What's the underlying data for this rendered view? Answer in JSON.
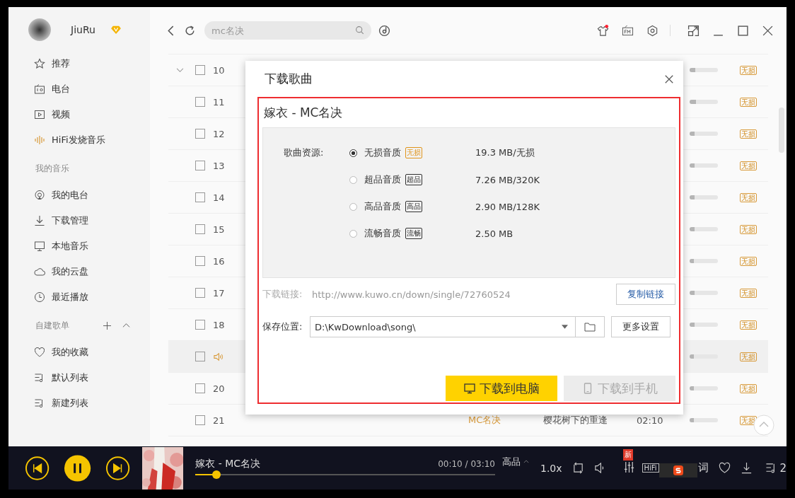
{
  "user": {
    "name": "JiuRu"
  },
  "search": {
    "placeholder": "mc名决"
  },
  "sidebar": {
    "items": [
      {
        "label": "推荐"
      },
      {
        "label": "电台"
      },
      {
        "label": "视频"
      },
      {
        "label": "HiFi发烧音乐"
      }
    ],
    "sections": [
      {
        "title": "我的音乐",
        "items": [
          {
            "label": "我的电台"
          },
          {
            "label": "下载管理"
          },
          {
            "label": "本地音乐"
          },
          {
            "label": "我的云盘"
          },
          {
            "label": "最近播放"
          }
        ]
      },
      {
        "title": "自建歌单",
        "items": [
          {
            "label": "我的收藏"
          },
          {
            "label": "默认列表"
          },
          {
            "label": "新建列表"
          }
        ]
      }
    ]
  },
  "tracks": [
    {
      "number": "10",
      "toggle": true,
      "checked": false,
      "playing": false,
      "level": 0.2,
      "badge": "无损"
    },
    {
      "number": "11",
      "toggle": false,
      "checked": false,
      "playing": false,
      "level": 0.22,
      "badge": "无损"
    },
    {
      "number": "12",
      "toggle": false,
      "checked": false,
      "playing": false,
      "level": 0.18,
      "badge": "无损"
    },
    {
      "number": "13",
      "toggle": false,
      "checked": false,
      "playing": false,
      "level": 0.18,
      "badge": "无损"
    },
    {
      "number": "14",
      "toggle": false,
      "checked": false,
      "playing": false,
      "level": 0.18,
      "badge": "无损"
    },
    {
      "number": "15",
      "toggle": false,
      "checked": false,
      "playing": false,
      "level": 0.18,
      "badge": "无损"
    },
    {
      "number": "16",
      "toggle": false,
      "checked": false,
      "playing": false,
      "level": 0.16,
      "badge": "无损"
    },
    {
      "number": "17",
      "toggle": false,
      "checked": false,
      "playing": false,
      "level": 0.18,
      "badge": "无损"
    },
    {
      "number": "18",
      "toggle": false,
      "checked": false,
      "playing": false,
      "level": 0.18,
      "badge": "无损"
    },
    {
      "toggle": false,
      "checked": false,
      "playing": true,
      "level": 0.16,
      "badge": "无损"
    },
    {
      "number": "20",
      "toggle": false,
      "checked": false,
      "playing": false,
      "level": 0.14,
      "badge": "无损"
    },
    {
      "number": "21",
      "toggle": false,
      "checked": false,
      "playing": false,
      "level": 0.16,
      "badge": "无损",
      "artist": "MC名决",
      "album": "樱花树下的重逢",
      "duration": "02:10"
    }
  ],
  "dialog": {
    "title": "下载歌曲",
    "song": "嫁衣 - MC名决",
    "source_label": "歌曲资源:",
    "options": [
      {
        "quality": "无损音质",
        "tag": "无损",
        "color": "#e0951c",
        "size": "19.3 MB/无损",
        "selected": true
      },
      {
        "quality": "超品音质",
        "tag": "超品",
        "color": "#333333",
        "size": "7.26 MB/320K",
        "selected": false
      },
      {
        "quality": "高品音质",
        "tag": "高品",
        "color": "#333333",
        "size": "2.90 MB/128K",
        "selected": false
      },
      {
        "quality": "流畅音质",
        "tag": "流畅",
        "color": "#333333",
        "size": "2.50 MB",
        "selected": false
      }
    ],
    "link_label": "下载链接:",
    "link": "http://www.kuwo.cn/down/single/72760524",
    "copy_button": "复制链接",
    "save_label": "保存位置:",
    "save_path": "D:\\KwDownload\\song\\",
    "more_button": "更多设置",
    "buttons": [
      {
        "label": "下载到电脑",
        "disabled": false
      },
      {
        "label": "下载到手机",
        "disabled": true
      }
    ]
  },
  "player": {
    "song": "嫁衣 - MC名决",
    "time": "00:10 / 03:10",
    "quality": "高品",
    "speed": "1.0x",
    "new_badge": "新",
    "hifi": "HiFi",
    "lyrics": "词",
    "playlist_count": "2"
  }
}
